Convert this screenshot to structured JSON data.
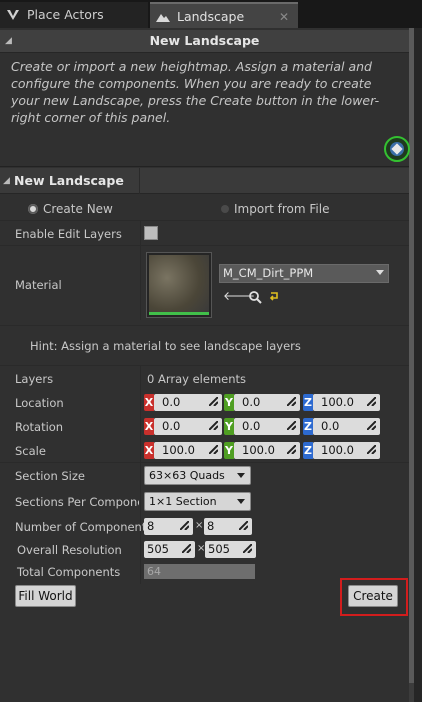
{
  "tabs": {
    "place_actors": "Place Actors",
    "landscape": "Landscape"
  },
  "new_landscape_header": "New Landscape",
  "description": "Create or import a new heightmap.  Assign a material and configure the components.  When you are ready to create your new Landscape, press the Create button in the lower-right corner of this panel.",
  "section_header": "New Landscape",
  "modes": {
    "create_new": "Create New",
    "import_from_file": "Import from File"
  },
  "labels": {
    "enable_edit_layers": "Enable Edit Layers",
    "material": "Material",
    "hint": "Hint: Assign a material to see landscape layers",
    "layers": "Layers",
    "location": "Location",
    "rotation": "Rotation",
    "scale": "Scale",
    "section_size": "Section Size",
    "sections_per_component": "Sections Per Component",
    "number_of_components": "Number of Components",
    "overall_resolution": "Overall Resolution",
    "total_components": "Total Components"
  },
  "values": {
    "material": "M_CM_Dirt_PPM",
    "layers": "0 Array elements",
    "location": {
      "x": "0.0",
      "y": "0.0",
      "z": "100.0"
    },
    "rotation": {
      "x": "0.0",
      "y": "0.0",
      "z": "0.0"
    },
    "scale": {
      "x": "100.0",
      "y": "100.0",
      "z": "100.0"
    },
    "section_size": "63×63 Quads",
    "sections_per_component": "1×1 Section",
    "components": {
      "x": "8",
      "y": "8"
    },
    "resolution": {
      "x": "505",
      "y": "505"
    },
    "total_components": "64",
    "times": "×"
  },
  "axis_letters": {
    "x": "X",
    "y": "Y",
    "z": "Z"
  },
  "buttons": {
    "fill_world": "Fill World",
    "create": "Create"
  },
  "colors": {
    "axis_x": "#c9302c",
    "axis_y": "#4f9e22",
    "axis_z": "#2d6ad0",
    "highlight": "#d21d1d",
    "help_ring": "#34c131"
  }
}
